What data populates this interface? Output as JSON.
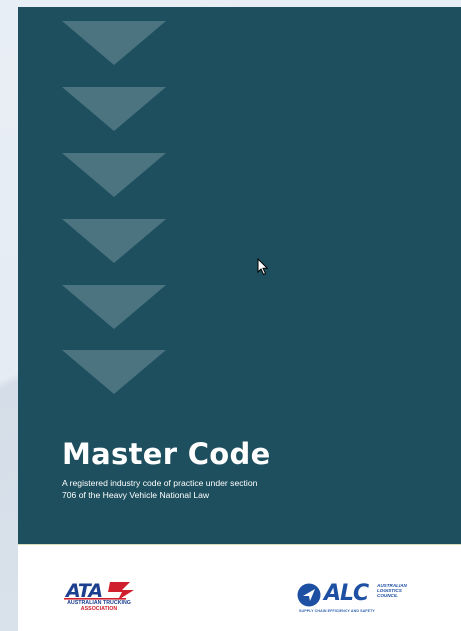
{
  "document": {
    "title": "Master Code",
    "subtitle_line1": "A registered industry code of practice under section",
    "subtitle_line2": "706 of the Heavy Vehicle National Law"
  },
  "logos": {
    "ata": {
      "mark": "ATA",
      "line1": "AUSTRALIAN TRUCKING",
      "line2": "ASSOCIATION"
    },
    "alc": {
      "mark": "ALC",
      "line1": "AUSTRALIAN",
      "line2": "LOGISTICS",
      "line3": "COUNCIL",
      "tagline": "SUPPLY CHAIN EFFICIENCY AND SAFETY"
    }
  },
  "colors": {
    "cover": "#1e4f5e",
    "chevron": "#4b7480",
    "ata_blue": "#1d3f8f",
    "ata_red": "#d0202e",
    "alc_blue": "#1d4fa3"
  },
  "icons": {
    "decoration": "chevron-down-icon",
    "pointer": "mouse-pointer-icon"
  }
}
